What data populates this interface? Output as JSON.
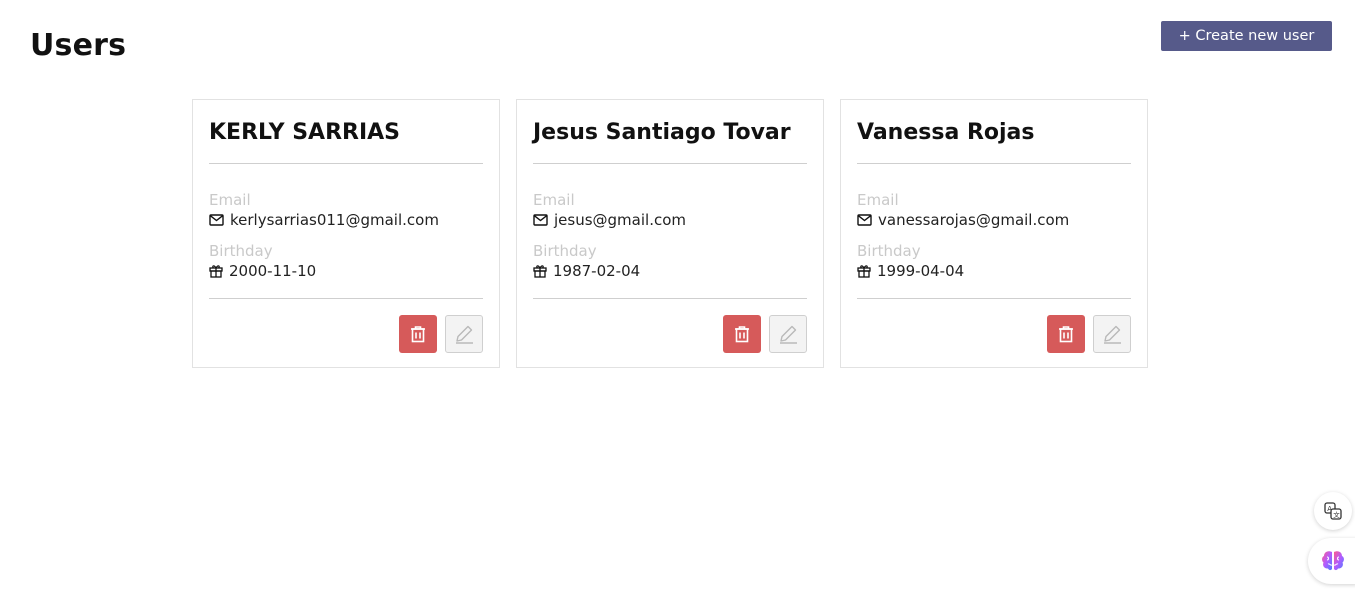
{
  "header": {
    "title": "Users",
    "create_button": {
      "icon": "plus-icon",
      "label": "+ Create new user"
    }
  },
  "users": [
    {
      "name": "KERLY SARRIAS",
      "email_label": "Email",
      "email": "kerlysarrias011@gmail.com",
      "birthday_label": "Birthday",
      "birthday": "2000-11-10"
    },
    {
      "name": "Jesus Santiago Tovar",
      "email_label": "Email",
      "email": "jesus@gmail.com",
      "birthday_label": "Birthday",
      "birthday": "1987-02-04"
    },
    {
      "name": "Vanessa Rojas",
      "email_label": "Email",
      "email": "vanessarojas@gmail.com",
      "birthday_label": "Birthday",
      "birthday": "1999-04-04"
    }
  ],
  "icons": {
    "email": "mail-icon",
    "birthday": "gift-icon",
    "delete": "trash-icon",
    "edit": "pencil-icon",
    "translate": "translate-icon",
    "assistant": "brain-icon"
  },
  "colors": {
    "primary": "#565a8a",
    "delete": "#d65a5a",
    "label_muted": "#c9c9c9",
    "divider": "#cfcfcf"
  }
}
